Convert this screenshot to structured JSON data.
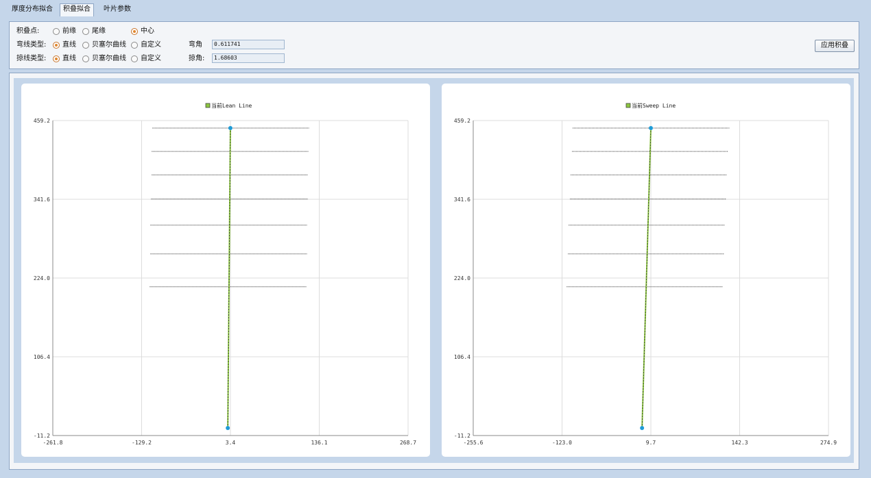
{
  "tabs": [
    {
      "label": "厚度分布拟合",
      "active": false
    },
    {
      "label": "积叠拟合",
      "active": true
    },
    {
      "label": "叶片参数",
      "active": false
    }
  ],
  "controls": {
    "stack_point": {
      "label": "积叠点:",
      "options": [
        "前缘",
        "尾缘",
        "中心"
      ],
      "selected": 2
    },
    "lean_type": {
      "label": "弯线类型:",
      "options": [
        "直线",
        "贝塞尔曲线",
        "自定义"
      ],
      "selected": 0,
      "angle_label": "弯角",
      "angle_value": "0.611741"
    },
    "sweep_type": {
      "label": "掠线类型:",
      "options": [
        "直线",
        "贝塞尔曲线",
        "自定义"
      ],
      "selected": 0,
      "angle_label": "掠角:",
      "angle_value": "1.68603"
    },
    "apply_label": "应用积叠"
  },
  "colors": {
    "line": "#8cc63f",
    "point": "#1e9bd7",
    "legend_box": "#8cc63f",
    "selected_radio": "#e08830"
  },
  "chart_data": [
    {
      "type": "line",
      "legend": "当前Lean Line",
      "xlim": [
        -261.8,
        268.7
      ],
      "ylim": [
        -11.2,
        459.2
      ],
      "x_ticks": [
        "-261.8",
        "-129.2",
        "3.4",
        "136.1",
        "268.7"
      ],
      "y_ticks": [
        "459.2",
        "341.6",
        "224.0",
        "106.4",
        "-11.2"
      ],
      "series": [
        {
          "points": [
            [
              -0.5,
              0
            ],
            [
              3.4,
              448
            ]
          ]
        }
      ],
      "sections": [
        {
          "y": 448,
          "x0": -113,
          "x1": 121
        },
        {
          "y": 413,
          "x0": -114,
          "x1": 120
        },
        {
          "y": 378,
          "x0": -114,
          "x1": 119
        },
        {
          "y": 342,
          "x0": -115,
          "x1": 119
        },
        {
          "y": 303,
          "x0": -116,
          "x1": 118
        },
        {
          "y": 260,
          "x0": -116,
          "x1": 118
        },
        {
          "y": 211,
          "x0": -117,
          "x1": 117
        }
      ]
    },
    {
      "type": "line",
      "legend": "当前Sweep Line",
      "xlim": [
        -255.6,
        274.9
      ],
      "ylim": [
        -11.2,
        459.2
      ],
      "x_ticks": [
        "-255.6",
        "-123.0",
        "9.7",
        "142.3",
        "274.9"
      ],
      "y_ticks": [
        "459.2",
        "341.6",
        "224.0",
        "106.4",
        "-11.2"
      ],
      "series": [
        {
          "points": [
            [
              -3.5,
              0
            ],
            [
              9.7,
              448
            ]
          ]
        }
      ],
      "sections": [
        {
          "y": 448,
          "x0": -107,
          "x1": 127
        },
        {
          "y": 413,
          "x0": -108,
          "x1": 125
        },
        {
          "y": 378,
          "x0": -110,
          "x1": 123
        },
        {
          "y": 342,
          "x0": -111,
          "x1": 122
        },
        {
          "y": 303,
          "x0": -113,
          "x1": 120
        },
        {
          "y": 260,
          "x0": -114,
          "x1": 119
        },
        {
          "y": 211,
          "x0": -116,
          "x1": 117
        }
      ]
    }
  ]
}
